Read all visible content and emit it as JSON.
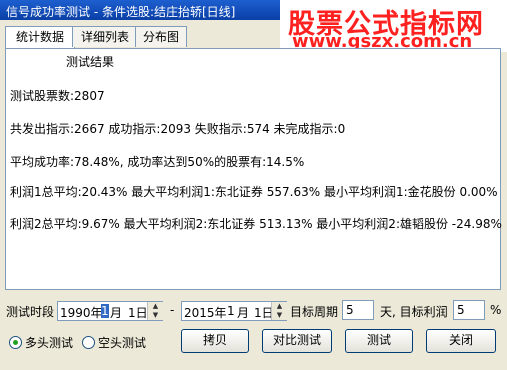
{
  "window": {
    "title": "信号成功率测试 - 条件选股:结庄抬轿[日线]"
  },
  "watermark": {
    "line1": "股票公式指标网",
    "line2": "www.gszx.com.cn"
  },
  "tabs": [
    "统计数据",
    "详细列表",
    "分布图"
  ],
  "results": {
    "heading": "测试结果",
    "stock_count": "测试股票数:2807",
    "signals": "共发出指示:2667 成功指示:2093 失败指示:574 未完成指示:0",
    "success_rate": "平均成功率:78.48%, 成功率达到50%的股票有:14.5%",
    "profit1": "利润1总平均:20.43% 最大平均利润1:东北证券 557.63% 最小平均利润1:金花股份 0.00%",
    "profit2": "利润2总平均:9.67% 最大平均利润2:东北证券 513.13% 最小平均利润2:雄韬股份 -24.98%"
  },
  "controls": {
    "period_label": "测试时段",
    "start_date": {
      "year": "1990年",
      "month": "1",
      "month_unit": "月",
      "day": "1日"
    },
    "separator": "-",
    "end_date": {
      "year": "2015年",
      "month": "1",
      "month_unit": "月",
      "day": "1日"
    },
    "target_period_label": "目标周期",
    "target_period_value": "5",
    "day_unit": "天, 目标利润",
    "target_profit_value": "5",
    "percent": "%",
    "long_label": "多头测试",
    "short_label": "空头测试",
    "long_selected": true
  },
  "buttons": {
    "copy": "拷贝",
    "compare": "对比测试",
    "test": "测试",
    "close": "关闭"
  }
}
